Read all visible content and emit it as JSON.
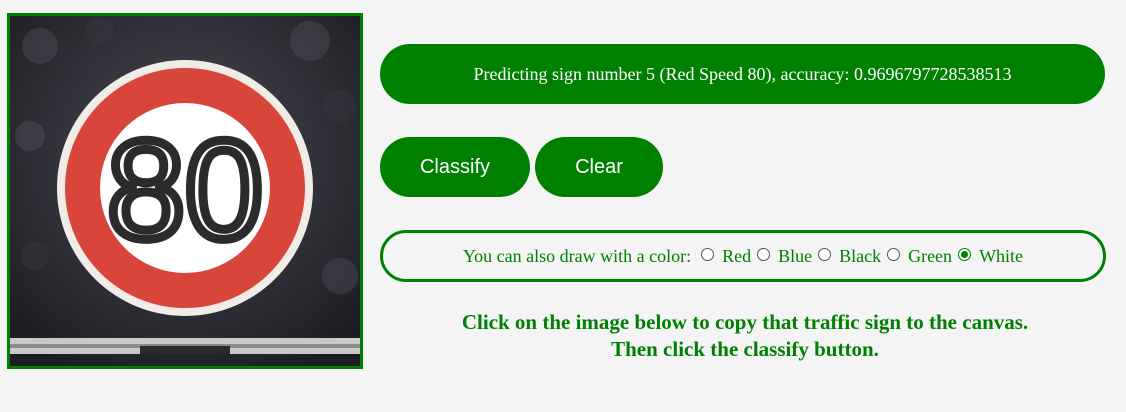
{
  "canvas": {
    "sign_text": "80",
    "sign_colors": {
      "ring": "#d8453a",
      "inner": "#ffffff",
      "digits": "#2b2b2b",
      "background": "#2a2a30"
    }
  },
  "status": {
    "text": "Predicting sign number 5 (Red Speed 80), accuracy: 0.9696797728538513"
  },
  "buttons": {
    "classify_label": "Classify",
    "clear_label": "Clear"
  },
  "color_picker": {
    "prompt": "You can also draw with a color:",
    "options": [
      {
        "label": "Red",
        "checked": false
      },
      {
        "label": "Blue",
        "checked": false
      },
      {
        "label": "Black",
        "checked": false
      },
      {
        "label": "Green",
        "checked": false
      },
      {
        "label": "White",
        "checked": true
      }
    ]
  },
  "instructions": {
    "line1": "Click on the image below to copy that traffic sign to the canvas.",
    "line2": "Then click the classify button."
  },
  "theme": {
    "accent": "#008000",
    "background": "#f4f4f4"
  }
}
